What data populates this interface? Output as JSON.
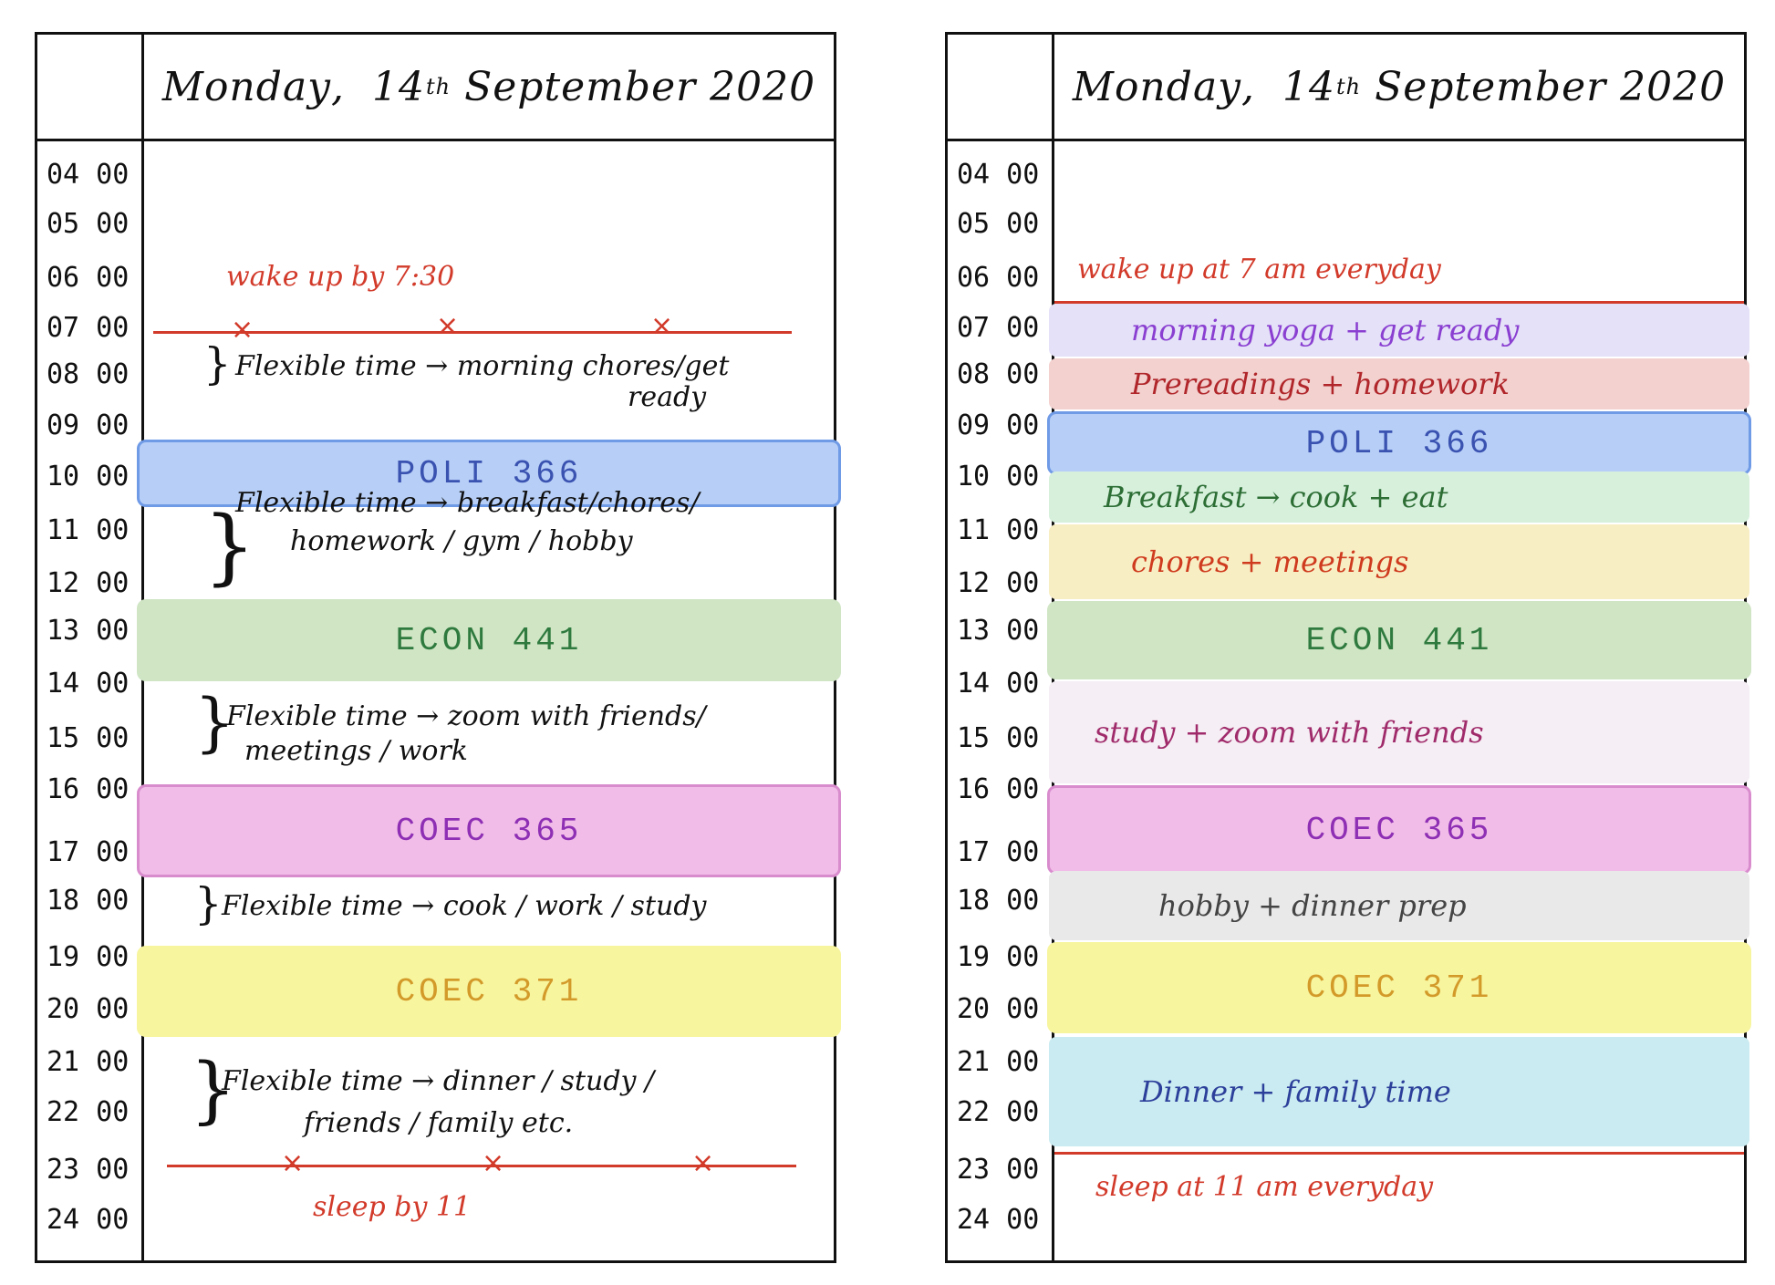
{
  "date": {
    "weekday": "Monday",
    "day": "14",
    "suffix": "th",
    "month_year": "September 2020"
  },
  "times": [
    "04 00",
    "05 00",
    "06 00",
    "07 00",
    "08 00",
    "09 00",
    "10 00",
    "11 00",
    "12 00",
    "13 00",
    "14 00",
    "15 00",
    "16 00",
    "17 00",
    "18 00",
    "19 00",
    "20 00",
    "21 00",
    "22 00",
    "23 00",
    "24 00"
  ],
  "left": {
    "wake": "wake up by 7:30",
    "flex1_a": "Flexible time → morning chores/get",
    "flex1_b": "ready",
    "class1": "POLI 366",
    "flex2_a": "Flexible time → breakfast/chores/",
    "flex2_b": "homework / gym / hobby",
    "class2": "ECON 441",
    "flex3_a": "Flexible time → zoom with friends/",
    "flex3_b": "meetings / work",
    "class3": "COEC 365",
    "flex4": "Flexible time → cook / work / study",
    "class4": "COEC 371",
    "flex5_a": "Flexible time → dinner / study /",
    "flex5_b": "friends / family etc.",
    "sleep": "sleep by 11"
  },
  "right": {
    "wake": "wake up at 7 am everyday",
    "b1": "morning yoga + get ready",
    "b2": "Prereadings + homework",
    "class1": "POLI 366",
    "b3": "Breakfast → cook + eat",
    "b4": "chores + meetings",
    "class2": "ECON 441",
    "b5": "study + zoom with friends",
    "class3": "COEC 365",
    "b6": "hobby + dinner prep",
    "class4": "COEC 371",
    "b7": "Dinner + family time",
    "sleep": "sleep at 11 am everyday"
  },
  "colors": {
    "poli": "#b7cff7",
    "econ": "#cfe5c4",
    "coec365": "#f1bde8",
    "coec371": "#f7f59e",
    "yoga": "#e4e1f8",
    "prereading": "#f3d1cf",
    "breakfast": "#d6f0dc",
    "chores": "#f8eec4",
    "study": "#f5eef4",
    "hobby": "#e9e9e9",
    "dinner": "#c9ebf1",
    "red": "#d23a2a"
  }
}
